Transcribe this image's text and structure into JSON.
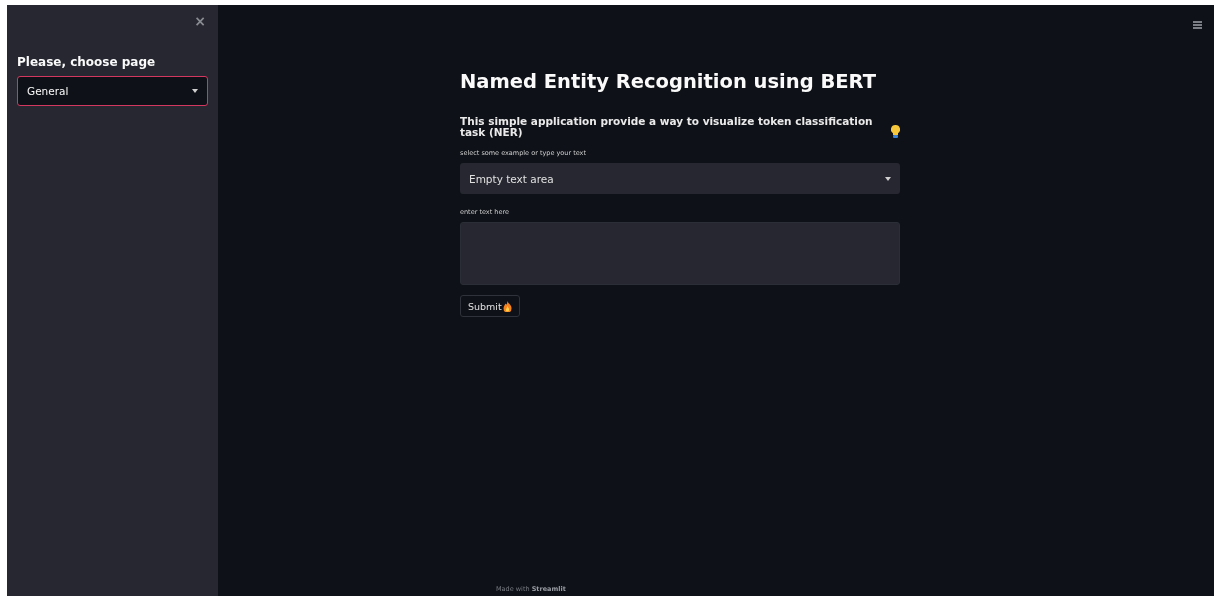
{
  "sidebar": {
    "close": "×",
    "heading": "Please, choose page",
    "page_select": {
      "value": "General",
      "focused": true
    }
  },
  "main": {
    "title": "Named Entity Recognition using BERT",
    "subtitle": "This simple application provide a way to visualize token classification task (NER)",
    "example_select": {
      "label": "select some example or type your text",
      "value": "Empty text area"
    },
    "text_area": {
      "label": "enter text here"
    },
    "submit": "Submit",
    "footer": "Made with **Streamlit**"
  }
}
